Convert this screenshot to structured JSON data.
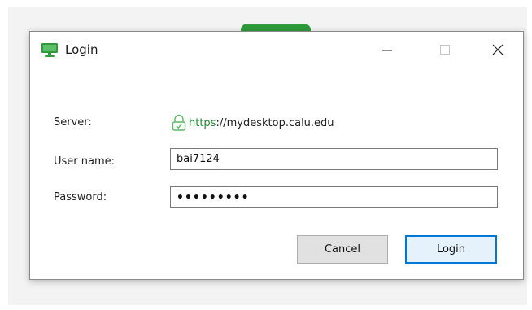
{
  "window": {
    "title": "Login",
    "minimize_label": "—",
    "maximize_label": "☐",
    "close_label": "✕"
  },
  "form": {
    "server_label": "Server:",
    "server_scheme": "https",
    "server_rest": "://mydesktop.calu.edu",
    "username_label": "User name:",
    "username_value": "bai7124",
    "password_label": "Password:",
    "password_value": "•••••••••"
  },
  "buttons": {
    "cancel": "Cancel",
    "login": "Login"
  },
  "colors": {
    "accent": "#0078d7",
    "secure_green": "#1e8a2e",
    "app_icon_green": "#2f9a3a"
  },
  "icons": {
    "app": "monitor-icon",
    "lock": "lock-icon"
  }
}
